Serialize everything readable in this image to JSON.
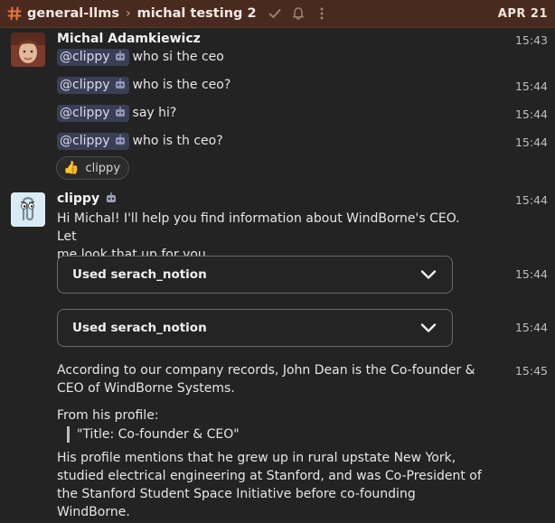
{
  "header": {
    "channel": "general-llms",
    "thread": "michal testing 2",
    "date": "APR 21"
  },
  "messages": {
    "user": {
      "author": "Michal Adamkiewicz",
      "time": "15:43",
      "lines": [
        {
          "mention": "@clippy",
          "text": "who si the ceo",
          "time": ""
        },
        {
          "mention": "@clippy",
          "text": "who is the ceo?",
          "time": "15:44"
        },
        {
          "mention": "@clippy",
          "text": "say hi?",
          "time": "15:44"
        },
        {
          "mention": "@clippy",
          "text": "who is th ceo?",
          "time": "15:44"
        }
      ],
      "reaction": {
        "emoji": "👍",
        "label": "clippy"
      }
    },
    "bot": {
      "author": "clippy",
      "time": "15:44",
      "intro_line1": "Hi Michal! I'll help you find information about WindBorne's CEO. Let",
      "intro_line2": "me look that up for you.",
      "tools": [
        {
          "label": "Used serach_notion",
          "time": "15:44"
        },
        {
          "label": "Used serach_notion",
          "time": "15:44"
        }
      ],
      "answer_time": "15:45",
      "answer_line1": "According to our company records, John Dean is the Co-founder &",
      "answer_line2": "CEO of WindBorne Systems.",
      "profile_intro": "From his profile:",
      "quote": "\"Title: Co-founder & CEO\"",
      "bio_line1": "His profile mentions that he grew up in rural upstate New York,",
      "bio_line2": "studied electrical engineering at Stanford, and was Co-President of",
      "bio_line3": "the Stanford Student Space Initiative before co-founding",
      "bio_line4": "WindBorne."
    }
  },
  "colors": {
    "header_bg": "#4a2a1e",
    "hash_accent": "#e8743b",
    "background": "#232323",
    "mention_bg": "#3a3f55"
  }
}
